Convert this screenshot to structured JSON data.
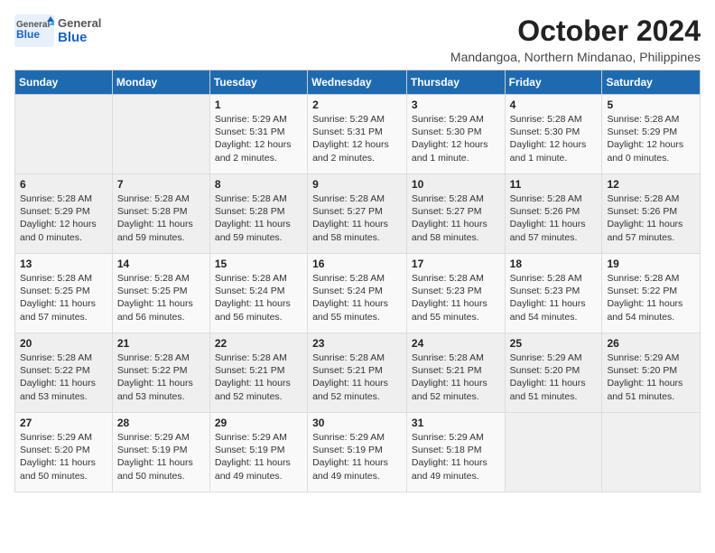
{
  "header": {
    "logo_general": "General",
    "logo_blue": "Blue",
    "month_title": "October 2024",
    "subtitle": "Mandangoa, Northern Mindanao, Philippines"
  },
  "weekdays": [
    "Sunday",
    "Monday",
    "Tuesday",
    "Wednesday",
    "Thursday",
    "Friday",
    "Saturday"
  ],
  "weeks": [
    [
      {
        "day": "",
        "info": ""
      },
      {
        "day": "",
        "info": ""
      },
      {
        "day": "1",
        "info": "Sunrise: 5:29 AM\nSunset: 5:31 PM\nDaylight: 12 hours and 2 minutes."
      },
      {
        "day": "2",
        "info": "Sunrise: 5:29 AM\nSunset: 5:31 PM\nDaylight: 12 hours and 2 minutes."
      },
      {
        "day": "3",
        "info": "Sunrise: 5:29 AM\nSunset: 5:30 PM\nDaylight: 12 hours and 1 minute."
      },
      {
        "day": "4",
        "info": "Sunrise: 5:28 AM\nSunset: 5:30 PM\nDaylight: 12 hours and 1 minute."
      },
      {
        "day": "5",
        "info": "Sunrise: 5:28 AM\nSunset: 5:29 PM\nDaylight: 12 hours and 0 minutes."
      }
    ],
    [
      {
        "day": "6",
        "info": "Sunrise: 5:28 AM\nSunset: 5:29 PM\nDaylight: 12 hours and 0 minutes."
      },
      {
        "day": "7",
        "info": "Sunrise: 5:28 AM\nSunset: 5:28 PM\nDaylight: 11 hours and 59 minutes."
      },
      {
        "day": "8",
        "info": "Sunrise: 5:28 AM\nSunset: 5:28 PM\nDaylight: 11 hours and 59 minutes."
      },
      {
        "day": "9",
        "info": "Sunrise: 5:28 AM\nSunset: 5:27 PM\nDaylight: 11 hours and 58 minutes."
      },
      {
        "day": "10",
        "info": "Sunrise: 5:28 AM\nSunset: 5:27 PM\nDaylight: 11 hours and 58 minutes."
      },
      {
        "day": "11",
        "info": "Sunrise: 5:28 AM\nSunset: 5:26 PM\nDaylight: 11 hours and 57 minutes."
      },
      {
        "day": "12",
        "info": "Sunrise: 5:28 AM\nSunset: 5:26 PM\nDaylight: 11 hours and 57 minutes."
      }
    ],
    [
      {
        "day": "13",
        "info": "Sunrise: 5:28 AM\nSunset: 5:25 PM\nDaylight: 11 hours and 57 minutes."
      },
      {
        "day": "14",
        "info": "Sunrise: 5:28 AM\nSunset: 5:25 PM\nDaylight: 11 hours and 56 minutes."
      },
      {
        "day": "15",
        "info": "Sunrise: 5:28 AM\nSunset: 5:24 PM\nDaylight: 11 hours and 56 minutes."
      },
      {
        "day": "16",
        "info": "Sunrise: 5:28 AM\nSunset: 5:24 PM\nDaylight: 11 hours and 55 minutes."
      },
      {
        "day": "17",
        "info": "Sunrise: 5:28 AM\nSunset: 5:23 PM\nDaylight: 11 hours and 55 minutes."
      },
      {
        "day": "18",
        "info": "Sunrise: 5:28 AM\nSunset: 5:23 PM\nDaylight: 11 hours and 54 minutes."
      },
      {
        "day": "19",
        "info": "Sunrise: 5:28 AM\nSunset: 5:22 PM\nDaylight: 11 hours and 54 minutes."
      }
    ],
    [
      {
        "day": "20",
        "info": "Sunrise: 5:28 AM\nSunset: 5:22 PM\nDaylight: 11 hours and 53 minutes."
      },
      {
        "day": "21",
        "info": "Sunrise: 5:28 AM\nSunset: 5:22 PM\nDaylight: 11 hours and 53 minutes."
      },
      {
        "day": "22",
        "info": "Sunrise: 5:28 AM\nSunset: 5:21 PM\nDaylight: 11 hours and 52 minutes."
      },
      {
        "day": "23",
        "info": "Sunrise: 5:28 AM\nSunset: 5:21 PM\nDaylight: 11 hours and 52 minutes."
      },
      {
        "day": "24",
        "info": "Sunrise: 5:28 AM\nSunset: 5:21 PM\nDaylight: 11 hours and 52 minutes."
      },
      {
        "day": "25",
        "info": "Sunrise: 5:29 AM\nSunset: 5:20 PM\nDaylight: 11 hours and 51 minutes."
      },
      {
        "day": "26",
        "info": "Sunrise: 5:29 AM\nSunset: 5:20 PM\nDaylight: 11 hours and 51 minutes."
      }
    ],
    [
      {
        "day": "27",
        "info": "Sunrise: 5:29 AM\nSunset: 5:20 PM\nDaylight: 11 hours and 50 minutes."
      },
      {
        "day": "28",
        "info": "Sunrise: 5:29 AM\nSunset: 5:19 PM\nDaylight: 11 hours and 50 minutes."
      },
      {
        "day": "29",
        "info": "Sunrise: 5:29 AM\nSunset: 5:19 PM\nDaylight: 11 hours and 49 minutes."
      },
      {
        "day": "30",
        "info": "Sunrise: 5:29 AM\nSunset: 5:19 PM\nDaylight: 11 hours and 49 minutes."
      },
      {
        "day": "31",
        "info": "Sunrise: 5:29 AM\nSunset: 5:18 PM\nDaylight: 11 hours and 49 minutes."
      },
      {
        "day": "",
        "info": ""
      },
      {
        "day": "",
        "info": ""
      }
    ]
  ]
}
